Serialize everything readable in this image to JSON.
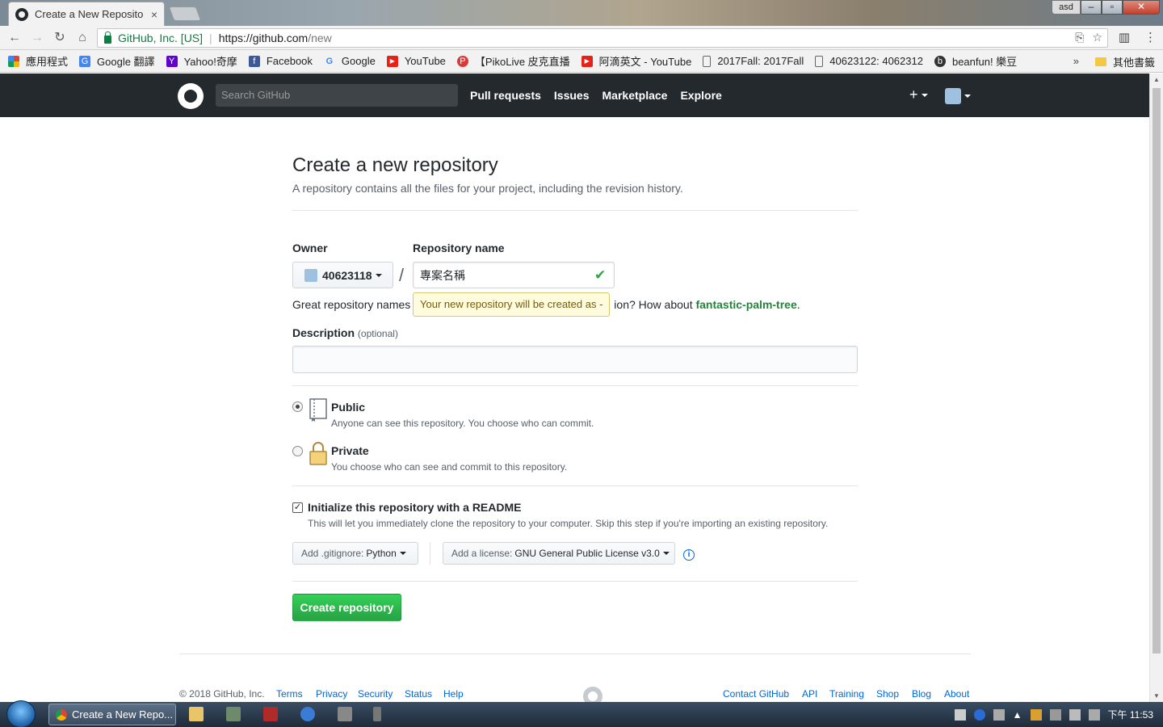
{
  "browser": {
    "tab_title": "Create a New Reposito",
    "tab_close": "×",
    "site_identity": "GitHub, Inc. [US]",
    "url_host": "https://github.com",
    "url_path": "/new",
    "profile_label": "asd"
  },
  "bookmarks": [
    {
      "label": "應用程式",
      "icon": "apps-grid-icon"
    },
    {
      "label": "Google 翻譯",
      "icon": "google-translate-icon"
    },
    {
      "label": "Yahoo!奇摩",
      "icon": "yahoo-icon"
    },
    {
      "label": "Facebook",
      "icon": "facebook-icon"
    },
    {
      "label": "Google",
      "icon": "google-icon"
    },
    {
      "label": "YouTube",
      "icon": "youtube-icon"
    },
    {
      "label": "【PikoLive 皮克直播",
      "icon": "pikolive-icon"
    },
    {
      "label": "阿滴英文 - YouTube",
      "icon": "youtube-icon"
    },
    {
      "label": "2017Fall: 2017Fall",
      "icon": "page-icon"
    },
    {
      "label": "40623122: 4062312",
      "icon": "page-icon"
    },
    {
      "label": "beanfun! 樂豆",
      "icon": "beanfun-icon"
    }
  ],
  "bookmarks_more": "»",
  "bookmarks_other": "其他書籤",
  "github": {
    "search_placeholder": "Search GitHub",
    "nav": [
      "Pull requests",
      "Issues",
      "Marketplace",
      "Explore"
    ],
    "plus": "+"
  },
  "form": {
    "title": "Create a new repository",
    "subtitle": "A repository contains all the files for your project, including the revision history.",
    "owner_label": "Owner",
    "owner_value": "40623118",
    "slash": "/",
    "repo_name_label": "Repository name",
    "repo_name_value": "專案名稱",
    "hint_prefix": "Great repository names",
    "hint_suffix": "ion? How about ",
    "hint_suggestion": "fantastic-palm-tree",
    "hint_end": ".",
    "tooltip": "Your new repository will be created as -",
    "description_label": "Description",
    "description_optional": "(optional)",
    "description_value": "",
    "public_title": "Public",
    "public_note": "Anyone can see this repository. You choose who can commit.",
    "private_title": "Private",
    "private_note": "You choose who can see and commit to this repository.",
    "readme_label": "Initialize this repository with a README",
    "readme_note": "This will let you immediately clone the repository to your computer. Skip this step if you're importing an existing repository.",
    "readme_checked": true,
    "visibility": "public",
    "gitignore_key": "Add .gitignore:",
    "gitignore_value": "Python",
    "license_key": "Add a license:",
    "license_value": "GNU General Public License v3.0",
    "info": "i",
    "create_button": "Create repository"
  },
  "footer": {
    "copyright": "© 2018 GitHub, Inc.",
    "left_links": [
      "Terms",
      "Privacy",
      "Security",
      "Status",
      "Help"
    ],
    "right_links": [
      "Contact GitHub",
      "API",
      "Training",
      "Shop",
      "Blog",
      "About"
    ]
  },
  "taskbar": {
    "task_title": "Create a New Repo...",
    "clock": "下午 11:53"
  }
}
